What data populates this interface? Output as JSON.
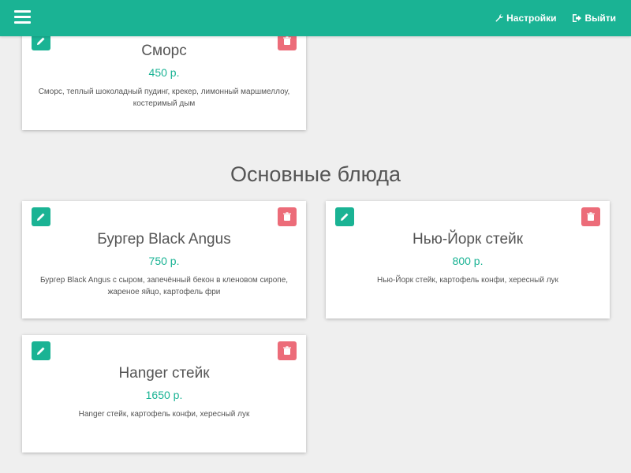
{
  "navbar": {
    "settings_label": "Настройки",
    "logout_label": "Выйти",
    "accent_color": "#1ab394"
  },
  "top_card": {
    "title": "Сморс",
    "price": "450 р.",
    "description_line1": "Сморс, теплый шоколадный пудинг, крекер, лимонный маршмеллоу,",
    "description_line2": "костеримый дым"
  },
  "section": {
    "title": "Основные блюда"
  },
  "items": [
    {
      "title": "Бургер Black Angus",
      "price": "750 р.",
      "description_line1": "Бургер Black Angus с сыром, запечённый бекон в кленовом сиропе,",
      "description_line2": "жареное яйцо, картофель фри"
    },
    {
      "title": "Нью-Йорк стейк",
      "price": "800 р.",
      "description_line1": "Нью-Йорк стейк, картофель конфи, хересный лук",
      "description_line2": ""
    },
    {
      "title": "Hanger стейк",
      "price": "1650 р.",
      "description_line1": "Hanger стейк, картофель конфи, хересный лук",
      "description_line2": ""
    }
  ],
  "colors": {
    "edit_button": "#1ab394",
    "delete_button": "#ec6c79"
  },
  "icons": {
    "menu": "hamburger-icon",
    "settings": "wrench-icon",
    "logout": "sign-out-icon",
    "edit": "pencil-icon",
    "delete": "trash-icon"
  }
}
